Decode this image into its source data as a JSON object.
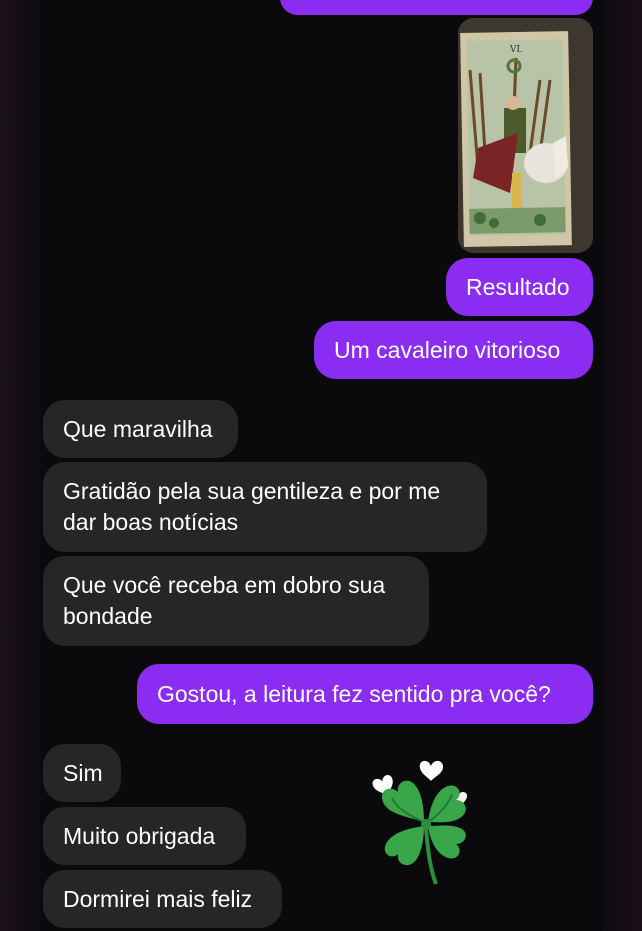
{
  "colors": {
    "outgoing_bubble": "#8a2cf1",
    "incoming_bubble": "#262629",
    "background": "#0a0a0c",
    "text": "#ffffff"
  },
  "image_message": {
    "card_numeral": "VI.",
    "icon": "tarot-card-six-of-wands-photo"
  },
  "messages": [
    {
      "direction": "outgoing",
      "text": "Resultado"
    },
    {
      "direction": "outgoing",
      "text": "Um cavaleiro vitorioso"
    },
    {
      "direction": "incoming",
      "text": "Que maravilha"
    },
    {
      "direction": "incoming",
      "text": "Gratidão pela sua gentileza e por me\ndar boas notícias"
    },
    {
      "direction": "incoming",
      "text": "Que você receba em dobro sua\nbondade"
    },
    {
      "direction": "outgoing",
      "text": "Gostou, a leitura fez sentido pra você?"
    },
    {
      "direction": "incoming",
      "text": "Sim"
    },
    {
      "direction": "incoming",
      "text": "Muito obrigada"
    },
    {
      "direction": "incoming",
      "text": "Dormirei mais feliz"
    }
  ],
  "sticker": {
    "icon": "four-leaf-clover-hearts-sticker"
  }
}
